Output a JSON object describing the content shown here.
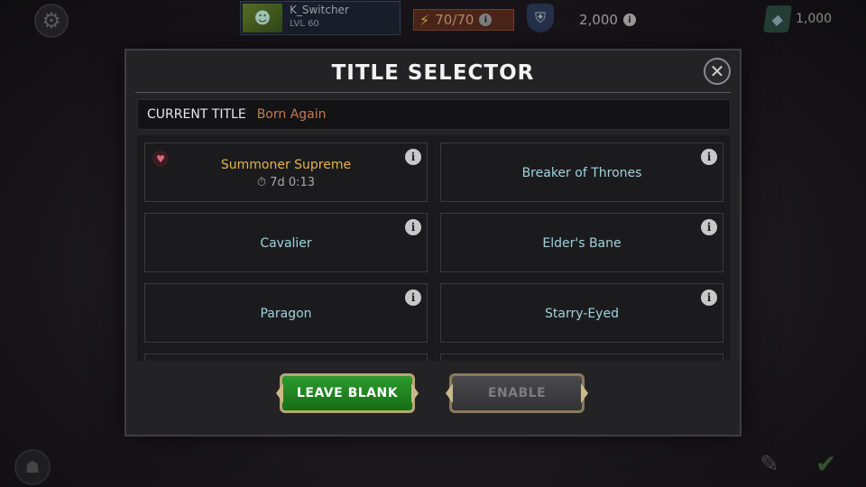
{
  "hud": {
    "player_name": "K_Switcher",
    "player_level": "LVL 60",
    "energy": "70/70",
    "gold": "2,000",
    "units": "1,000"
  },
  "modal": {
    "title": "TITLE SELECTOR",
    "current_label": "CURRENT TITLE",
    "current_value": "Born Again",
    "titles": [
      {
        "name": "Summoner Supreme",
        "timer": "7d 0:13",
        "highlight": true
      },
      {
        "name": "Breaker of Thrones"
      },
      {
        "name": "Cavalier"
      },
      {
        "name": "Elder's Bane"
      },
      {
        "name": "Paragon"
      },
      {
        "name": "Starry-Eyed"
      }
    ],
    "leave_blank_label": "LEAVE BLANK",
    "enable_label": "ENABLE"
  },
  "icons": {
    "info": "i",
    "close": "✕",
    "timer": "⏱",
    "settings": "⚙"
  },
  "colors": {
    "title_cyan": "#9fd3de",
    "title_gold": "#e8b24a",
    "current_value": "#c07a55",
    "leave_green": "#2c9a2c"
  }
}
